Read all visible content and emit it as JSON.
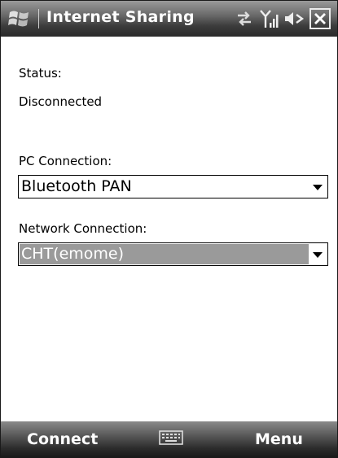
{
  "titlebar": {
    "title": "Internet Sharing",
    "icons": [
      "windows-start-icon",
      "data-connection-icon",
      "signal-strength-icon",
      "speaker-icon",
      "close-icon"
    ]
  },
  "status": {
    "label": "Status:",
    "value": "Disconnected"
  },
  "pc_connection": {
    "label": "PC Connection:",
    "value": "Bluetooth PAN"
  },
  "network_connection": {
    "label": "Network Connection:",
    "value": "CHT(emome)"
  },
  "menubar": {
    "left_softkey": "Connect",
    "right_softkey": "Menu",
    "center_icon": "keyboard-icon"
  },
  "colors": {
    "title_bar": "#3c3c3c",
    "selected_field": "#9a9a9a"
  }
}
